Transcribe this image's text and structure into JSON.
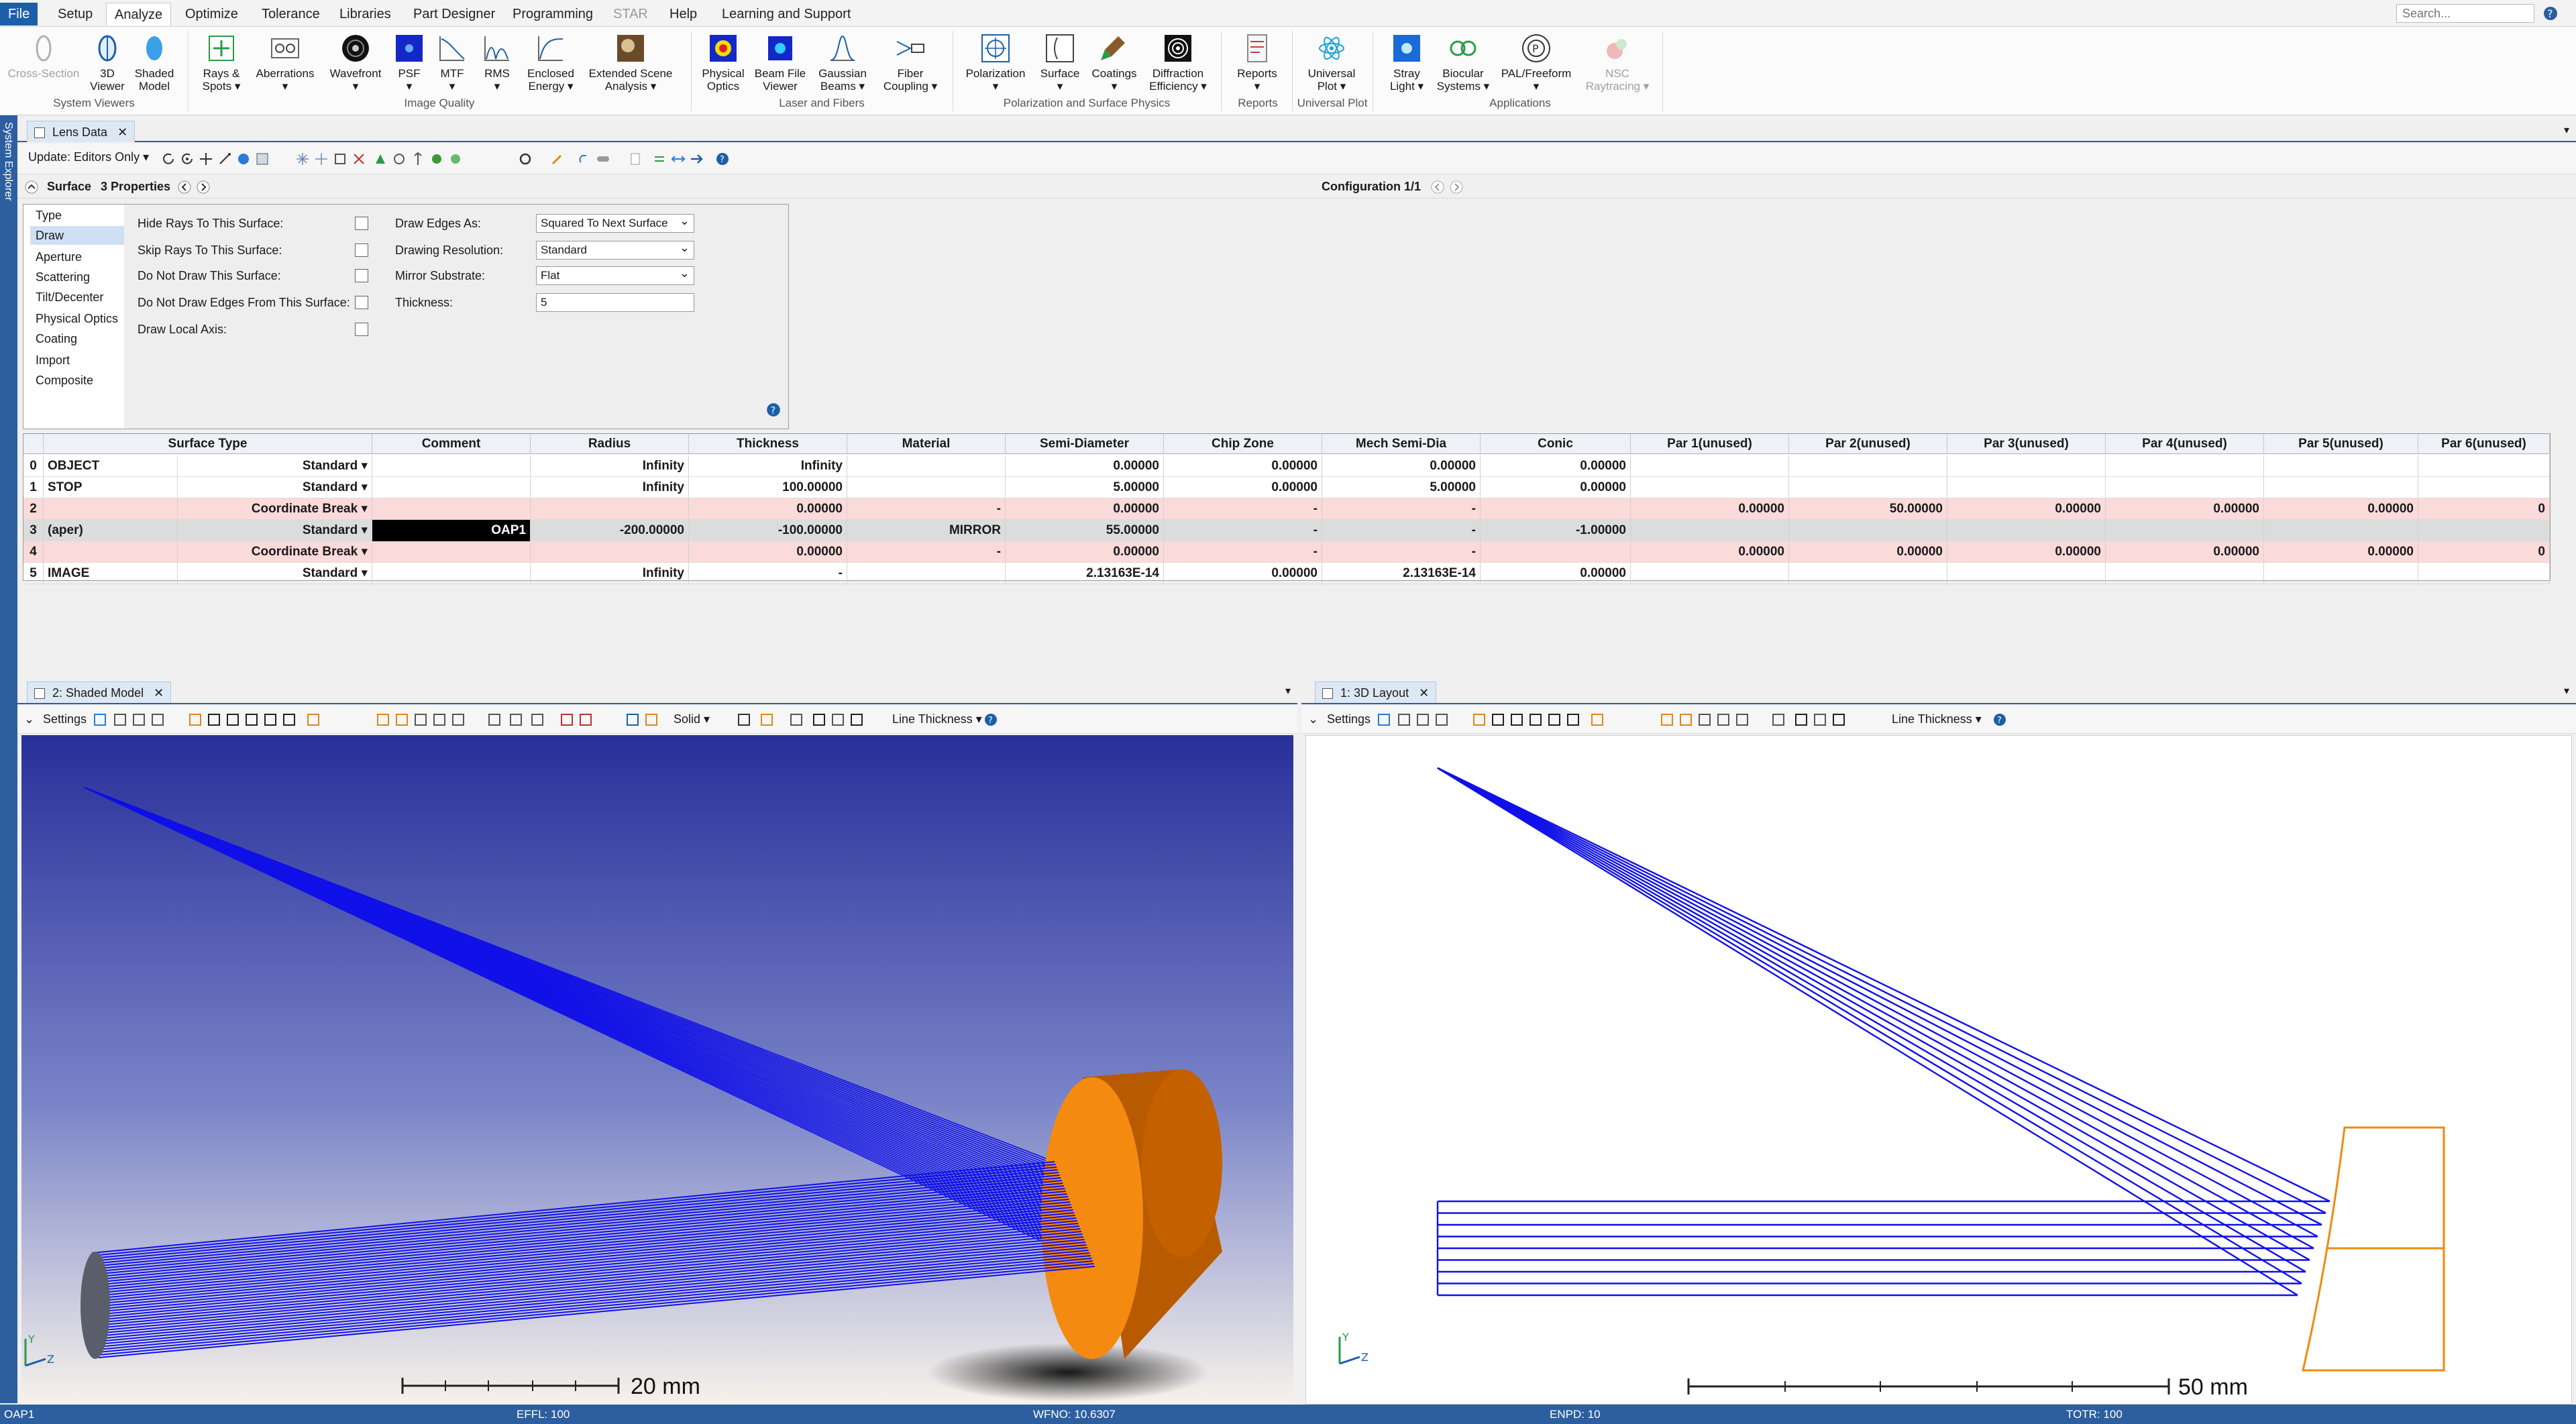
{
  "menu": {
    "file": "File",
    "setup": "Setup",
    "analyze": "Analyze",
    "optimize": "Optimize",
    "tolerance": "Tolerance",
    "libraries": "Libraries",
    "part_designer": "Part Designer",
    "programming": "Programming",
    "star": "STAR",
    "help": "Help",
    "learning": "Learning and Support",
    "search_placeholder": "Search..."
  },
  "ribbon": {
    "cross_section": "Cross-Section",
    "viewer3d_1": "3D",
    "viewer3d_2": "Viewer",
    "shaded_1": "Shaded",
    "shaded_2": "Model",
    "rays_1": "Rays &",
    "rays_2": "Spots ▾",
    "aberrations_1": "Aberrations",
    "aberrations_2": "▾",
    "wavefront_1": "Wavefront",
    "wavefront_2": "▾",
    "psf_1": "PSF",
    "psf_2": "▾",
    "mtf_1": "MTF",
    "mtf_2": "▾",
    "rms_1": "RMS",
    "rms_2": "▾",
    "enclosed_1": "Enclosed",
    "enclosed_2": "Energy ▾",
    "extended_1": "Extended Scene",
    "extended_2": "Analysis ▾",
    "physical_1": "Physical",
    "physical_2": "Optics",
    "beamfile_1": "Beam File",
    "beamfile_2": "Viewer",
    "gaussian_1": "Gaussian",
    "gaussian_2": "Beams ▾",
    "fiber_1": "Fiber",
    "fiber_2": "Coupling ▾",
    "polarization_1": "Polarization",
    "polarization_2": "▾",
    "surface_1": "Surface",
    "surface_2": "▾",
    "coatings_1": "Coatings",
    "coatings_2": "▾",
    "diffraction_1": "Diffraction",
    "diffraction_2": "Efficiency ▾",
    "reports_1": "Reports",
    "reports_2": "▾",
    "universal_1": "Universal",
    "universal_2": "Plot ▾",
    "stray_1": "Stray",
    "stray_2": "Light ▾",
    "biocular_1": "Biocular",
    "biocular_2": "Systems ▾",
    "pal_1": "PAL/Freeform",
    "pal_2": "▾",
    "nsc_1": "NSC",
    "nsc_2": "Raytracing ▾",
    "groups": {
      "system_viewers": "System Viewers",
      "image_quality": "Image Quality",
      "laser": "Laser and Fibers",
      "polarization": "Polarization and Surface Physics",
      "reports": "Reports",
      "universal": "Universal Plot",
      "applications": "Applications"
    }
  },
  "side_strip": "System Explorer",
  "lens_window": {
    "tab": "Lens Data",
    "update": "Update: Editors Only ▾",
    "surface_label": "Surface",
    "surface_props": "3 Properties",
    "configuration": "Configuration 1/1"
  },
  "props": {
    "categories": [
      "Type",
      "Draw",
      "Aperture",
      "Scattering",
      "Tilt/Decenter",
      "Physical Optics",
      "Coating",
      "Import",
      "Composite"
    ],
    "hide_rays": "Hide Rays To This Surface:",
    "skip_rays": "Skip Rays To This Surface:",
    "no_draw": "Do Not Draw This Surface:",
    "no_edges": "Do Not Draw Edges From This Surface:",
    "draw_axis": "Draw Local Axis:",
    "draw_edges_label": "Draw Edges As:",
    "draw_edges_value": "Squared To Next Surface",
    "resolution_label": "Drawing Resolution:",
    "resolution_value": "Standard",
    "mirror_label": "Mirror Substrate:",
    "mirror_value": "Flat",
    "thickness_label": "Thickness:",
    "thickness_value": "5"
  },
  "grid": {
    "headers": [
      "Surface Type",
      "Comment",
      "Radius",
      "Thickness",
      "Material",
      "Semi-Diameter",
      "Chip Zone",
      "Mech Semi-Dia",
      "Conic",
      "Par 1(unused)",
      "Par 2(unused)",
      "Par 3(unused)",
      "Par 4(unused)",
      "Par 5(unused)",
      "Par 6(unused)"
    ],
    "rows": [
      {
        "num": "0",
        "name": "OBJECT",
        "type": "Standard ▾",
        "comment": "",
        "radius": "Infinity",
        "thickness": "Infinity",
        "material": "",
        "semi": "0.00000",
        "chip": "0.00000",
        "mech": "0.00000",
        "conic": "0.00000",
        "p1": "",
        "p2": "",
        "p3": "",
        "p4": "",
        "p5": "",
        "p6": ""
      },
      {
        "num": "1",
        "name": "STOP",
        "type": "Standard ▾",
        "comment": "",
        "radius": "Infinity",
        "thickness": "100.00000",
        "material": "",
        "semi": "5.00000",
        "chip": "0.00000",
        "mech": "5.00000",
        "conic": "0.00000",
        "p1": "",
        "p2": "",
        "p3": "",
        "p4": "",
        "p5": "",
        "p6": ""
      },
      {
        "num": "2",
        "name": "",
        "type": "Coordinate Break ▾",
        "comment": "",
        "radius": "",
        "thickness": "0.00000",
        "material": "-",
        "semi": "0.00000",
        "chip": "-",
        "mech": "-",
        "conic": "",
        "p1": "0.00000",
        "p2": "50.00000",
        "p3": "0.00000",
        "p4": "0.00000",
        "p5": "0.00000",
        "p6": "0"
      },
      {
        "num": "3",
        "name": "(aper)",
        "type": "Standard ▾",
        "comment": "OAP1",
        "radius": "-200.00000",
        "thickness": "-100.00000",
        "material": "MIRROR",
        "semi": "55.00000",
        "chip": "-",
        "mech": "-",
        "conic": "-1.00000",
        "p1": "",
        "p2": "",
        "p3": "",
        "p4": "",
        "p5": "",
        "p6": ""
      },
      {
        "num": "4",
        "name": "",
        "type": "Coordinate Break ▾",
        "comment": "",
        "radius": "",
        "thickness": "0.00000",
        "material": "-",
        "semi": "0.00000",
        "chip": "-",
        "mech": "-",
        "conic": "",
        "p1": "0.00000",
        "p2": "0.00000",
        "p3": "0.00000",
        "p4": "0.00000",
        "p5": "0.00000",
        "p6": "0"
      },
      {
        "num": "5",
        "name": "IMAGE",
        "type": "Standard ▾",
        "comment": "",
        "radius": "Infinity",
        "thickness": "-",
        "material": "",
        "semi": "2.13163E-14",
        "chip": "0.00000",
        "mech": "2.13163E-14",
        "conic": "0.00000",
        "p1": "",
        "p2": "",
        "p3": "",
        "p4": "",
        "p5": "",
        "p6": ""
      }
    ]
  },
  "shaded_window": {
    "tab": "2: Shaded Model",
    "settings": "Settings",
    "solid": "Solid ▾",
    "line_thickness": "Line Thickness ▾",
    "scale": "20 mm",
    "axis_y": "Y",
    "axis_z": "Z"
  },
  "layout_window": {
    "tab": "1: 3D Layout",
    "settings": "Settings",
    "line_thickness": "Line Thickness ▾",
    "scale": "50 mm",
    "axis_y": "Y",
    "axis_z": "Z"
  },
  "status": {
    "surface": "OAP1",
    "effl": "EFFL: 100",
    "wfno": "WFNO: 10.6307",
    "enpd": "ENPD: 10",
    "totr": "TOTR: 100"
  },
  "colors": {
    "accent": "#2d5fa0",
    "ray": "#1010e8",
    "mirror": "#f07800",
    "pink_row": "#fbdada"
  }
}
